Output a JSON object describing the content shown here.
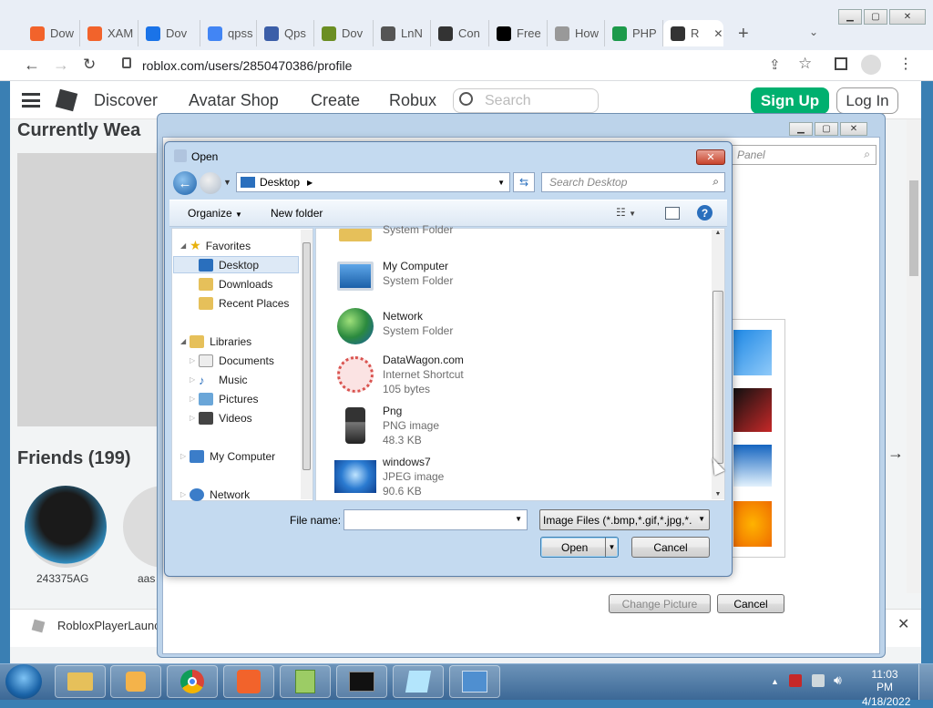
{
  "browser": {
    "tabs": [
      {
        "label": "Dow",
        "color": "#f2632b"
      },
      {
        "label": "XAM",
        "color": "#f2632b"
      },
      {
        "label": "Dov",
        "color": "#1a73e8"
      },
      {
        "label": "qpss",
        "color": "#4285f4"
      },
      {
        "label": "Qps",
        "color": "#3b5ea8"
      },
      {
        "label": "Dov",
        "color": "#6b8e23"
      },
      {
        "label": "LnN",
        "color": "#555555"
      },
      {
        "label": "Con",
        "color": "#333333"
      },
      {
        "label": "Free",
        "color": "#000000"
      },
      {
        "label": "How",
        "color": "#999999"
      },
      {
        "label": "PHP",
        "color": "#1d9a4b"
      },
      {
        "label": "R",
        "color": "#333333"
      }
    ],
    "url": "roblox.com/users/2850470386/profile"
  },
  "roblox": {
    "nav": [
      "Discover",
      "Avatar Shop",
      "Create",
      "Robux"
    ],
    "search_placeholder": "Search",
    "signup": "Sign Up",
    "login": "Log In",
    "currently_wearing": "Currently Wea",
    "friends": "Friends (199)",
    "friend_names": [
      "243375AG",
      "aas"
    ],
    "download_item": "RobloxPlayerLaunc"
  },
  "bg_dialog": {
    "search_placeholder": "Panel",
    "change_picture": "Change Picture",
    "cancel": "Cancel"
  },
  "open_dialog": {
    "title": "Open",
    "location": "Desktop",
    "search_placeholder": "Search Desktop",
    "organize": "Organize",
    "new_folder": "New folder",
    "nav": {
      "favorites": "Favorites",
      "desktop": "Desktop",
      "downloads": "Downloads",
      "recent": "Recent Places",
      "libraries": "Libraries",
      "documents": "Documents",
      "music": "Music",
      "pictures": "Pictures",
      "videos": "Videos",
      "computer": "My Computer",
      "network": "Network"
    },
    "files": [
      {
        "name": "",
        "sub": "System Folder"
      },
      {
        "name": "My Computer",
        "sub": "System Folder"
      },
      {
        "name": "Network",
        "sub": "System Folder"
      },
      {
        "name": "DataWagon.com",
        "sub": "Internet Shortcut",
        "sub2": "105 bytes"
      },
      {
        "name": "Png",
        "sub": "PNG image",
        "sub2": "48.3 KB"
      },
      {
        "name": "windows7",
        "sub": "JPEG image",
        "sub2": "90.6 KB"
      }
    ],
    "filename_label": "File name:",
    "filename_value": "",
    "filetype": "Image Files (*.bmp,*.gif,*.jpg,*.",
    "open": "Open",
    "cancel": "Cancel"
  },
  "taskbar": {
    "time": "11:03 PM",
    "date": "4/18/2022"
  }
}
